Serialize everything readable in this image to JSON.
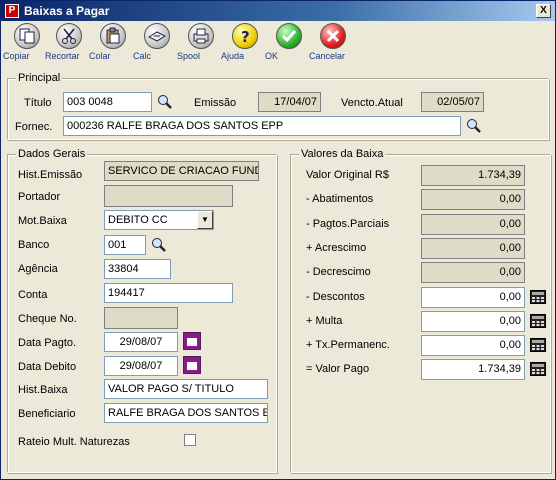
{
  "window": {
    "title": "Baixas a Pagar",
    "close_glyph": "X",
    "app_icon_glyph": "P"
  },
  "toolbar": {
    "items": [
      {
        "label": "Copiar",
        "icon": "copy-icon"
      },
      {
        "label": "Recortar",
        "icon": "scissors-icon"
      },
      {
        "label": "Colar",
        "icon": "paste-icon"
      },
      {
        "label": "Calc",
        "icon": "calculator-icon"
      },
      {
        "label": "Spool",
        "icon": "printer-icon"
      },
      {
        "label": "Ajuda",
        "icon": "help-icon"
      },
      {
        "label": "OK",
        "icon": "check-icon"
      },
      {
        "label": "Cancelar",
        "icon": "cancel-icon"
      }
    ]
  },
  "principal": {
    "legend": "Principal",
    "titulo_label": "Título",
    "titulo_value": "003 0048",
    "emissao_label": "Emissão",
    "emissao_value": "17/04/07",
    "vencto_label": "Vencto.Atual",
    "vencto_value": "02/05/07",
    "fornec_label": "Fornec.",
    "fornec_value": "000236 RALFE  BRAGA DOS SANTOS EPP"
  },
  "dados_gerais": {
    "legend": "Dados Gerais",
    "hist_emissao_label": "Hist.Emissão",
    "hist_emissao_value": "SERVICO DE CRIACAO FUNDAC",
    "portador_label": "Portador",
    "portador_value": "",
    "mot_baixa_label": "Mot.Baixa",
    "mot_baixa_value": "DEBITO CC",
    "banco_label": "Banco",
    "banco_value": "001",
    "agencia_label": "Agência",
    "agencia_value": "33804",
    "conta_label": "Conta",
    "conta_value": "194417",
    "cheque_label": "Cheque No.",
    "cheque_value": "",
    "data_pagto_label": "Data Pagto.",
    "data_pagto_value": "29/08/07",
    "data_debito_label": "Data Debito",
    "data_debito_value": "29/08/07",
    "hist_baixa_label": "Hist.Baixa",
    "hist_baixa_value": "VALOR PAGO S/ TITULO",
    "beneficiario_label": "Beneficiario",
    "beneficiario_value": "RALFE  BRAGA DOS SANTOS EP",
    "rateio_label": "Rateio Mult. Naturezas",
    "rateio_checked": false
  },
  "valores": {
    "legend": "Valores da Baixa",
    "rows": [
      {
        "label": "Valor Original R$",
        "value": "1.734,39",
        "editable": false
      },
      {
        "label": "- Abatimentos",
        "value": "0,00",
        "editable": false
      },
      {
        "label": "- Pagtos.Parciais",
        "value": "0,00",
        "editable": false
      },
      {
        "label": "+ Acrescimo",
        "value": "0,00",
        "editable": false
      },
      {
        "label": "- Decrescimo",
        "value": "0,00",
        "editable": false
      },
      {
        "label": "- Descontos",
        "value": "0,00",
        "editable": true
      },
      {
        "label": "+ Multa",
        "value": "0,00",
        "editable": true
      },
      {
        "label": "+ Tx.Permanenc.",
        "value": "0,00",
        "editable": true
      },
      {
        "label": "= Valor Pago",
        "value": "1.734,39",
        "editable": true
      }
    ]
  }
}
